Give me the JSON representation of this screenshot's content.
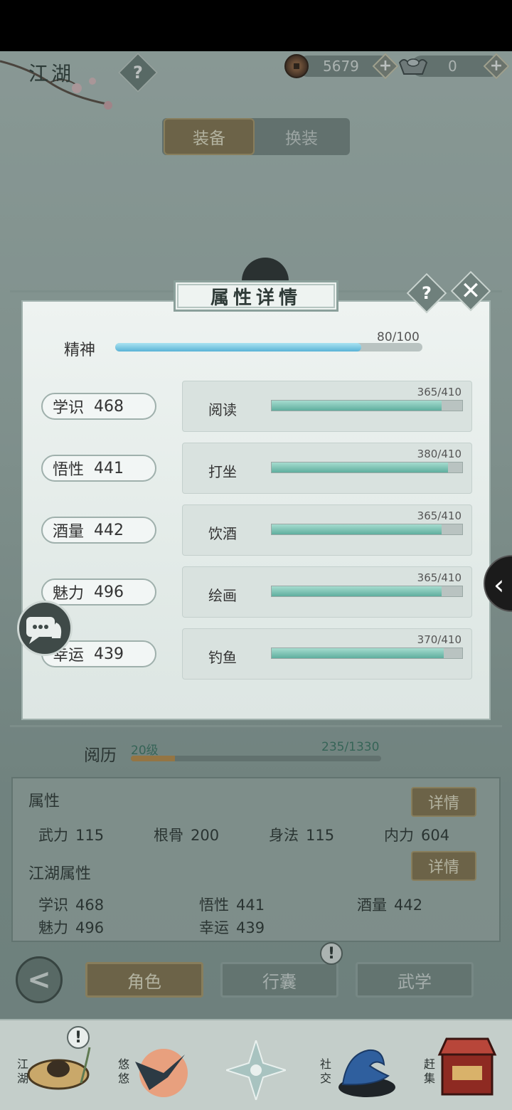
{
  "header": {
    "title": "江湖",
    "help_label": "?",
    "coins": "5679",
    "silver": "0",
    "plus_label": "+"
  },
  "tabs": [
    {
      "label": "装备",
      "active": true
    },
    {
      "label": "换装",
      "active": false
    }
  ],
  "modal": {
    "title": "属性详情",
    "help_label": "?",
    "close_label": "✕",
    "spirit": {
      "label": "精神",
      "value_text": "80/100",
      "current": 80,
      "max": 100
    },
    "stats": [
      {
        "name": "学识",
        "value": "468"
      },
      {
        "name": "悟性",
        "value": "441"
      },
      {
        "name": "酒量",
        "value": "442"
      },
      {
        "name": "魅力",
        "value": "496"
      },
      {
        "name": "幸运",
        "value": "439"
      }
    ],
    "activities": [
      {
        "name": "阅读",
        "value_text": "365/410",
        "current": 365,
        "max": 410
      },
      {
        "name": "打坐",
        "value_text": "380/410",
        "current": 380,
        "max": 410
      },
      {
        "name": "饮酒",
        "value_text": "365/410",
        "current": 365,
        "max": 410
      },
      {
        "name": "绘画",
        "value_text": "365/410",
        "current": 365,
        "max": 410
      },
      {
        "name": "钓鱼",
        "value_text": "370/410",
        "current": 370,
        "max": 410
      }
    ]
  },
  "experience": {
    "label": "阅历",
    "level": "20级",
    "value_text": "235/1330",
    "current": 235,
    "max": 1330
  },
  "attributes": {
    "title": "属性",
    "detail_label": "详情",
    "items": [
      {
        "name": "武力",
        "value": "115"
      },
      {
        "name": "根骨",
        "value": "200"
      },
      {
        "name": "身法",
        "value": "115"
      },
      {
        "name": "内力",
        "value": "604"
      }
    ]
  },
  "jianghu_attributes": {
    "title": "江湖属性",
    "detail_label": "详情",
    "items": [
      {
        "name": "学识",
        "value": "468"
      },
      {
        "name": "悟性",
        "value": "441"
      },
      {
        "name": "酒量",
        "value": "442"
      },
      {
        "name": "魅力",
        "value": "496"
      },
      {
        "name": "幸运",
        "value": "439"
      }
    ]
  },
  "bottom_buttons": {
    "back_label": "<",
    "items": [
      {
        "label": "角色",
        "active": true
      },
      {
        "label": "行囊",
        "active": false,
        "alert": true
      },
      {
        "label": "武学",
        "active": false
      }
    ],
    "alert_label": "!"
  },
  "bottom_nav": [
    {
      "label": "江湖",
      "icon": "straw-hat-icon",
      "alert": true
    },
    {
      "label": "悠悠",
      "icon": "swallow-icon",
      "alert": false
    },
    {
      "label": "",
      "icon": "compass-star-icon",
      "alert": false
    },
    {
      "label": "社交",
      "icon": "wave-icon",
      "alert": false
    },
    {
      "label": "赶集",
      "icon": "market-stall-icon",
      "alert": false
    }
  ],
  "colors": {
    "accent_gold": "#8d7852",
    "activity_fill": "#5fae9e",
    "spirit_fill": "#5ab3d6",
    "exp_fill": "#c8924a"
  }
}
